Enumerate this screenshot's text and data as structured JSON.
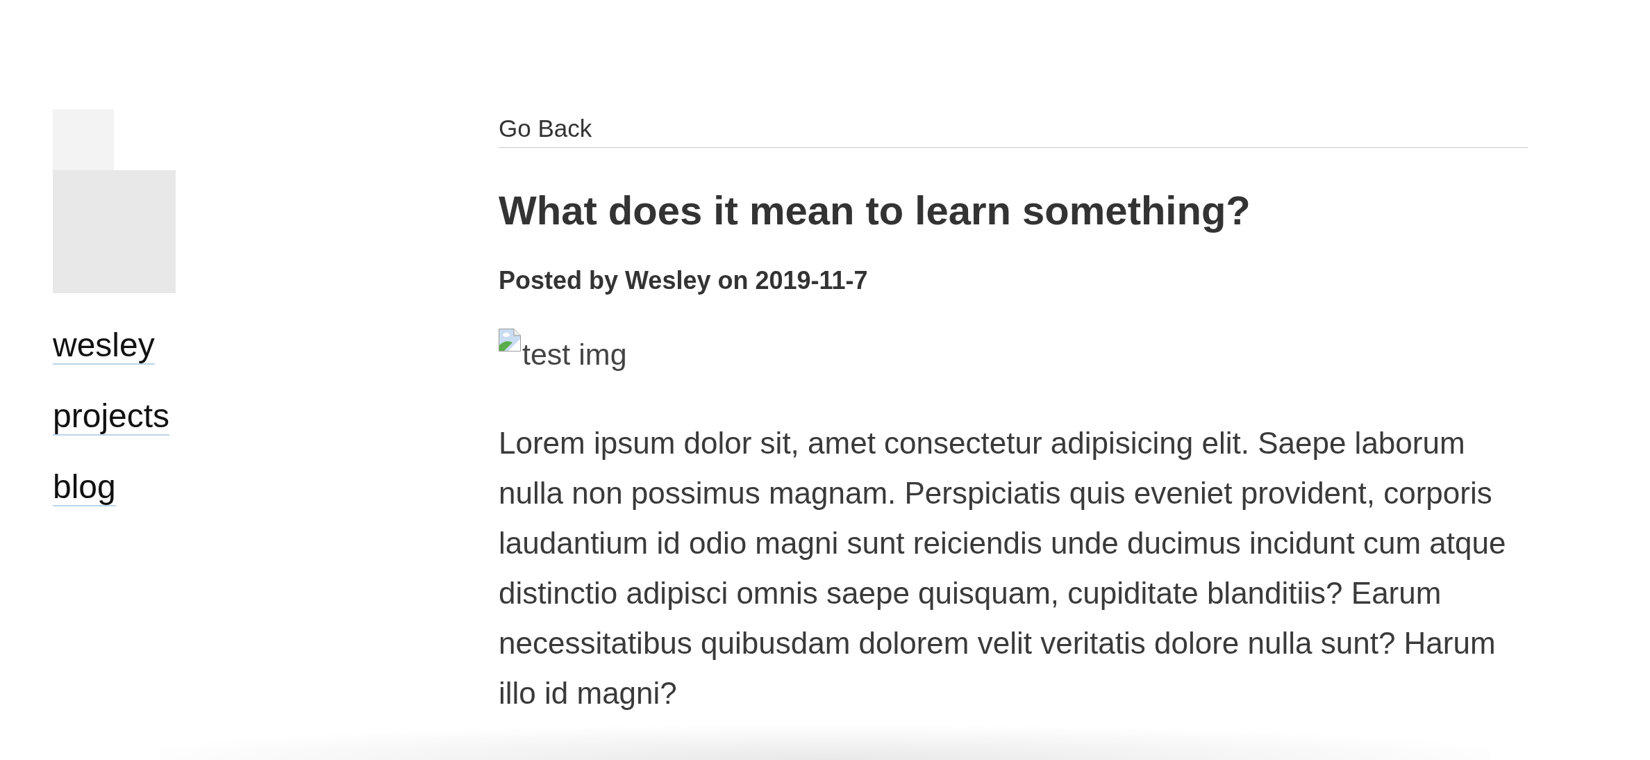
{
  "sidebar": {
    "links": [
      {
        "label": "wesley"
      },
      {
        "label": "projects"
      },
      {
        "label": "blog"
      }
    ]
  },
  "post": {
    "back_link": "Go Back",
    "title": "What does it mean to learn something?",
    "byline": "Posted by Wesley on 2019-11-7",
    "image": {
      "alt": "test img"
    },
    "body": "Lorem ipsum dolor sit, amet consectetur adipisicing elit. Saepe laborum nulla non possimus magnam. Perspiciatis quis eveniet provident, corporis laudantium id odio magni sunt reiciendis unde ducimus incidunt cum atque distinctio adipisci omnis saepe quisquam, cupiditate blanditiis? Earum necessitatibus quibusdam dolorem velit veritatis dolore nulla sunt? Harum illo id magni?"
  }
}
